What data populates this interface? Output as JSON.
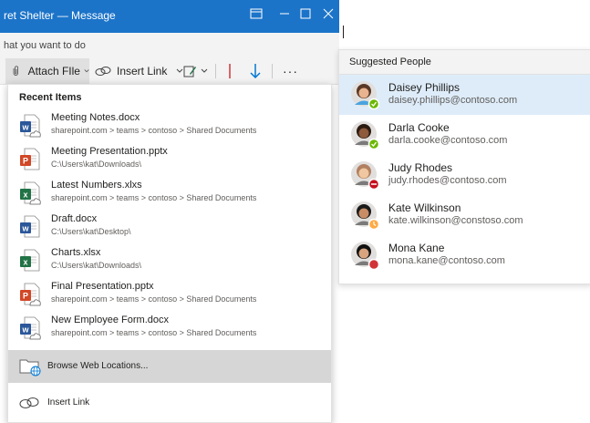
{
  "window": {
    "title": "ret Shelter — Message"
  },
  "tellme": {
    "text": "hat you want to do"
  },
  "ribbon": {
    "attach_label": "Attach FIle",
    "insert_link_label": "Insert Link",
    "more_label": "···"
  },
  "dropdown": {
    "header": "Recent Items",
    "items": [
      {
        "name": "Meeting Notes.docx",
        "path": "sharepoint.com > teams > contoso > Shared Documents",
        "icon": "word-cloud-icon"
      },
      {
        "name": "Meeting Presentation.pptx",
        "path": "C:\\Users\\kat\\Downloads\\",
        "icon": "powerpoint-icon"
      },
      {
        "name": "Latest Numbers.xlxs",
        "path": "sharepoint.com > teams > contoso > Shared Documents",
        "icon": "excel-cloud-icon"
      },
      {
        "name": "Draft.docx",
        "path": "C:\\Users\\kat\\Desktop\\",
        "icon": "word-icon"
      },
      {
        "name": "Charts.xlsx",
        "path": "C:\\Users\\kat\\Downloads\\",
        "icon": "excel-icon"
      },
      {
        "name": "Final Presentation.pptx",
        "path": "sharepoint.com > teams > contoso > Shared Documents",
        "icon": "powerpoint-cloud-icon"
      },
      {
        "name": "New Employee Form.docx",
        "path": "sharepoint.com > teams > contoso > Shared Documents",
        "icon": "word-cloud-icon"
      }
    ],
    "browse_label": "Browse Web Locations...",
    "insert_link_label": "Insert Link"
  },
  "people": {
    "header": "Suggested People",
    "list": [
      {
        "name": "Daisey Phillips",
        "email": "daisey.phillips@contoso.com",
        "status": "available",
        "status_color": "#6bb700"
      },
      {
        "name": "Darla Cooke",
        "email": "darla.cooke@contoso.com",
        "status": "available",
        "status_color": "#6bb700"
      },
      {
        "name": "Judy Rhodes",
        "email": "judy.rhodes@contoso.com",
        "status": "do-not-disturb",
        "status_color": "#c50f1f"
      },
      {
        "name": "Kate Wilkinson",
        "email": "kate.wilkinson@constoso.com",
        "status": "away",
        "status_color": "#ffaa44"
      },
      {
        "name": "Mona Kane",
        "email": "mona.kane@contoso.com",
        "status": "busy",
        "status_color": "#d13438"
      }
    ]
  },
  "colors": {
    "titlebar": "#1c74c9",
    "selected_row": "#deecf9",
    "word": "#2b579a",
    "excel": "#217346",
    "powerpoint": "#d24726",
    "accent_blue": "#0078d4",
    "accent_red": "#d13438"
  }
}
